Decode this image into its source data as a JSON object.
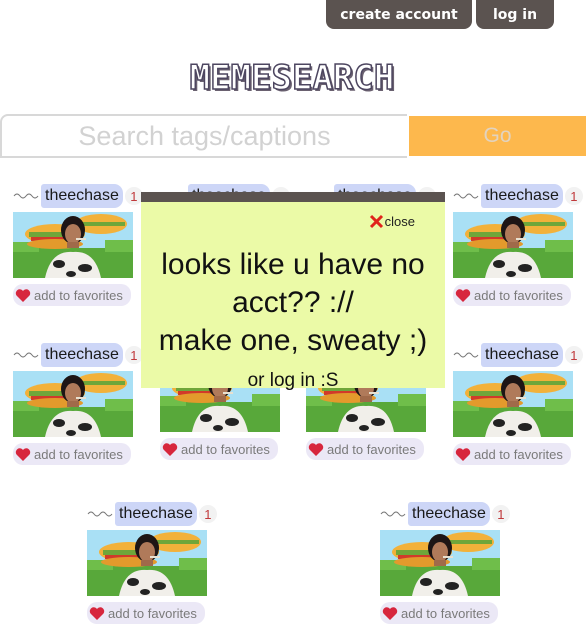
{
  "header": {
    "create_account": "create account",
    "login": "log in"
  },
  "logo": {
    "text": "MEMESEARCH"
  },
  "search": {
    "placeholder": "Search tags/captions",
    "go": "Go"
  },
  "card": {
    "username": "theechase",
    "count": "1",
    "favorite": "add to favorites"
  },
  "modal": {
    "close": "close",
    "line1": "looks like u have no",
    "line2": "acct?? ://",
    "line3": "make one, sweaty ;)",
    "sub": "or log in :S"
  },
  "colors": {
    "accent": "#fdb84d",
    "dark": "#5b5350",
    "modal_bg": "#ebfaa7",
    "user_bg": "#cdd6f7"
  }
}
